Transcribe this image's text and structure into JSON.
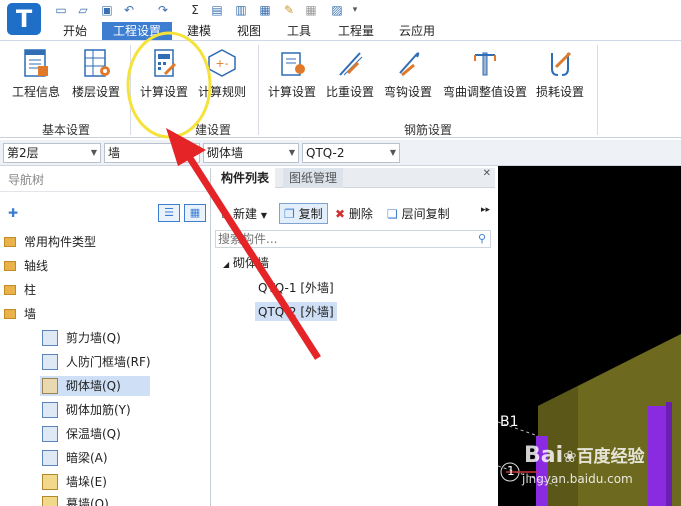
{
  "app": {
    "logo_letter": "T"
  },
  "tabs": [
    "开始",
    "工程设置",
    "建模",
    "视图",
    "工具",
    "工程量",
    "云应用"
  ],
  "active_tab": "工程设置",
  "ribbon": {
    "basic": {
      "b1": "工程信息",
      "b2": "楼层设置",
      "group": "基本设置"
    },
    "modeling": {
      "b1": "计算设置",
      "b2": "计算规则",
      "group": "建设置"
    },
    "rebar": {
      "b1": "计算设置",
      "b2": "比重设置",
      "b3": "弯钩设置",
      "b4": "弯曲调整值设置",
      "b5": "损耗设置",
      "group": "钢筋设置"
    }
  },
  "combos": {
    "floor": "第2层",
    "type": "墙",
    "subtype": "砌体墙",
    "component": "QTQ-2"
  },
  "nav": {
    "title": "导航树",
    "folders": [
      "常用构件类型",
      "轴线",
      "柱",
      "墙"
    ],
    "items": [
      "剪力墙(Q)",
      "人防门框墙(RF)",
      "砌体墙(Q)",
      "砌体加筋(Y)",
      "保温墙(Q)",
      "暗梁(A)",
      "墙垛(E)",
      "幕墙(Q)"
    ]
  },
  "list": {
    "tab1": "构件列表",
    "tab2": "图纸管理",
    "tools": {
      "new": "新建",
      "copy": "复制",
      "delete": "删除",
      "floor_copy": "层间复制"
    },
    "search_placeholder": "搜索构件...",
    "root": "砌体墙",
    "rows": [
      "QTQ-1 [外墙]",
      "QTQ-2 [外墙]"
    ]
  },
  "viewport": {
    "axis_label": "B1",
    "marker": "1",
    "watermark1": "Bai",
    "watermark2": "百度",
    "watermark3": "经验",
    "watermark_url": "jingyan.baidu.com"
  },
  "colors": {
    "accent": "#3d7ed0",
    "wall_yellow": "#6d6a1f",
    "purple": "#8a2be2"
  }
}
